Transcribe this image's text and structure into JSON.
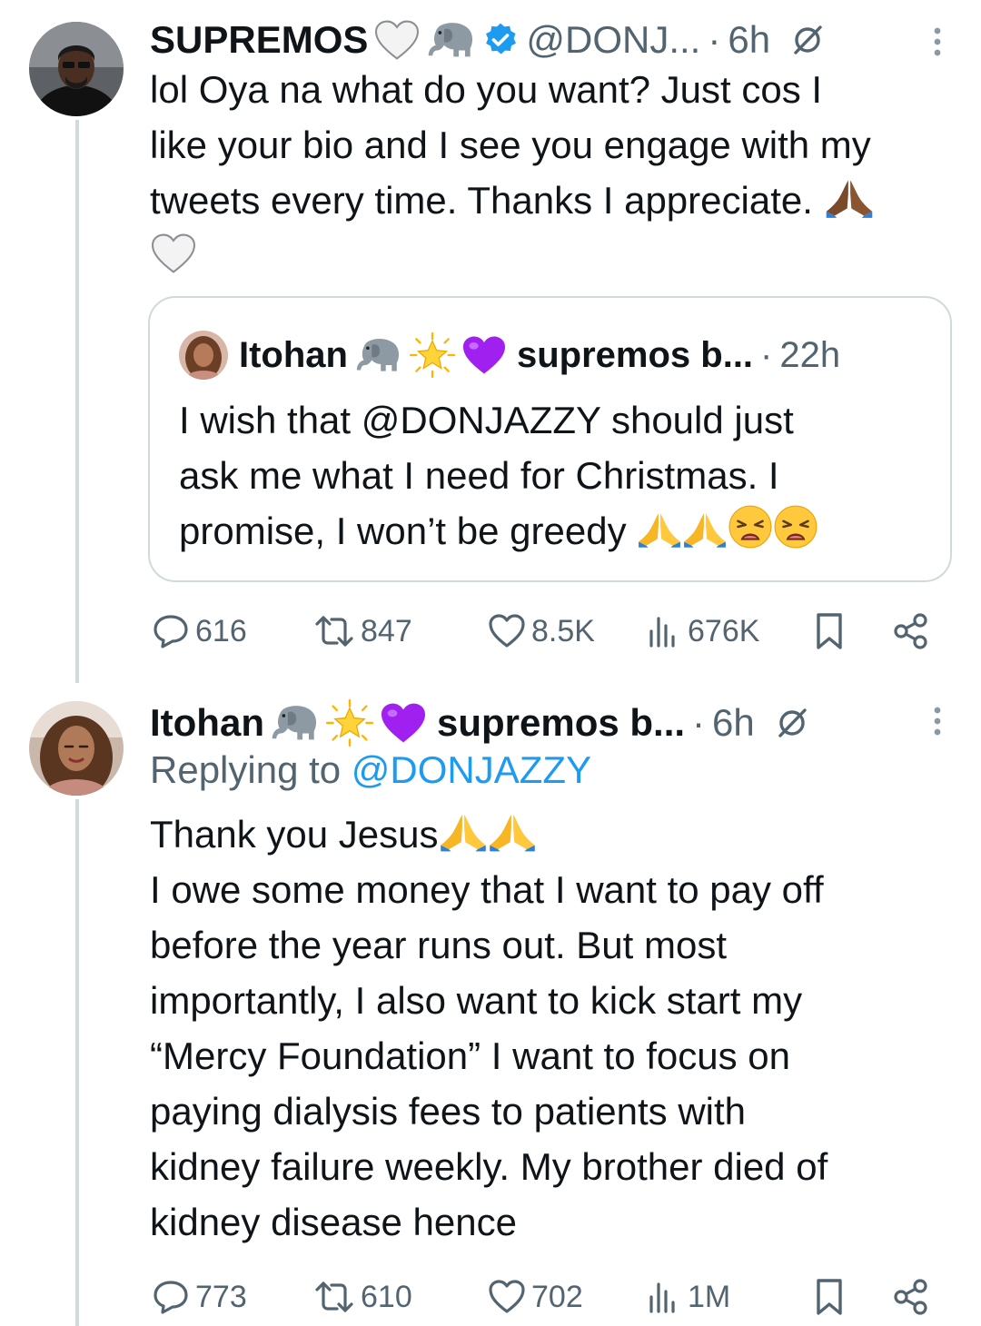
{
  "tweet1": {
    "author_name": "SUPREMOS",
    "author_emojis": [
      "white-heart",
      "elephant"
    ],
    "verified": true,
    "handle": "@DONJ...",
    "separator": "·",
    "time": "6h",
    "text_lines": [
      "lol Oya na what do you want? Just cos I",
      "like your bio and I see you engage with my",
      "tweets every time. Thanks I appreciate."
    ],
    "quote": {
      "author_name": "Itohan",
      "author_suffix": "supremos b...",
      "time": "22h",
      "text_lines": [
        "I wish that @DONJAZZY should just",
        "ask me what I need for Christmas. I",
        "promise, I won’t be greedy"
      ]
    },
    "actions": {
      "replies": "616",
      "retweets": "847",
      "likes": "8.5K",
      "views": "676K"
    }
  },
  "tweet2": {
    "author_name": "Itohan",
    "author_suffix": "supremos b...",
    "separator": "·",
    "time": "6h",
    "replying_prefix": "Replying to",
    "replying_to": "@DONJAZZY",
    "text_first": "Thank you Jesus",
    "text_lines": [
      "I owe some money that I want to pay off",
      "before the year runs out. But most",
      "importantly, I also want to kick start my",
      "“Mercy Foundation” I want to focus on",
      "paying dialysis fees to patients with",
      "kidney failure weekly. My brother died of",
      "kidney disease hence"
    ],
    "actions": {
      "replies": "773",
      "retweets": "610",
      "likes": "702",
      "views": "1M"
    }
  },
  "colors": {
    "text": "#0f1419",
    "secondary": "#536471",
    "link": "#1d9bf0",
    "border": "#cfd9de",
    "verified": "#1d9bf0"
  }
}
